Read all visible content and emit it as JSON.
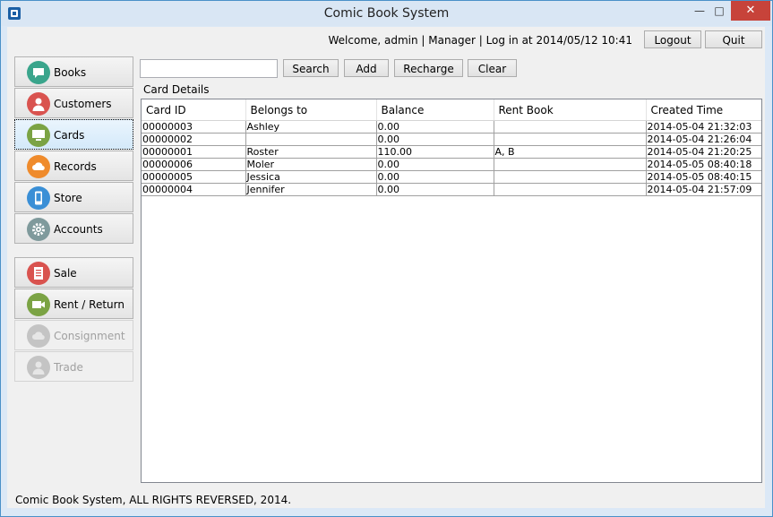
{
  "window": {
    "title": "Comic Book System",
    "min_icon": "minimize-icon",
    "max_icon": "maximize-icon",
    "close_icon": "close-icon"
  },
  "header": {
    "welcome": "Welcome, admin | Manager | Log in at 2014/05/12 10:41",
    "logout": "Logout",
    "quit": "Quit"
  },
  "nav": [
    {
      "label": "Books",
      "icon": "chat-bubble-icon",
      "color": "#3aa58c"
    },
    {
      "label": "Customers",
      "icon": "user-icon",
      "color": "#d9534f"
    },
    {
      "label": "Cards",
      "icon": "monitor-icon",
      "color": "#7ba344"
    },
    {
      "label": "Records",
      "icon": "cloud-icon",
      "color": "#ef8b2c"
    },
    {
      "label": "Store",
      "icon": "phone-icon",
      "color": "#3a8fd6"
    },
    {
      "label": "Accounts",
      "icon": "gear-icon",
      "color": "#7f9a9c"
    },
    {
      "label": "Sale",
      "icon": "document-icon",
      "color": "#d9534f"
    },
    {
      "label": "Rent / Return",
      "icon": "camera-icon",
      "color": "#7ba344"
    },
    {
      "label": "Consignment",
      "icon": "cloud-icon",
      "color": "#b8b8b8"
    },
    {
      "label": "Trade",
      "icon": "user-icon",
      "color": "#b8b8b8"
    }
  ],
  "toolbar": {
    "search_value": "",
    "search": "Search",
    "add": "Add",
    "recharge": "Recharge",
    "clear": "Clear"
  },
  "group_label": "Card Details",
  "table": {
    "columns": [
      "Card ID",
      "Belongs to",
      "Balance",
      "Rent Book",
      "Created Time"
    ],
    "rows": [
      [
        "00000003",
        "Ashley",
        "0.00",
        "",
        "2014-05-04 21:32:03"
      ],
      [
        "00000002",
        "",
        "0.00",
        "",
        "2014-05-04 21:26:04"
      ],
      [
        "00000001",
        "Roster",
        "110.00",
        "A, B",
        "2014-05-04 21:20:25"
      ],
      [
        "00000006",
        "Moler",
        "0.00",
        "",
        "2014-05-05 08:40:18"
      ],
      [
        "00000005",
        "Jessica",
        "0.00",
        "",
        "2014-05-05 08:40:15"
      ],
      [
        "00000004",
        "Jennifer",
        "0.00",
        "",
        "2014-05-04 21:57:09"
      ]
    ]
  },
  "footer": "Comic Book System, ALL RIGHTS REVERSED, 2014."
}
